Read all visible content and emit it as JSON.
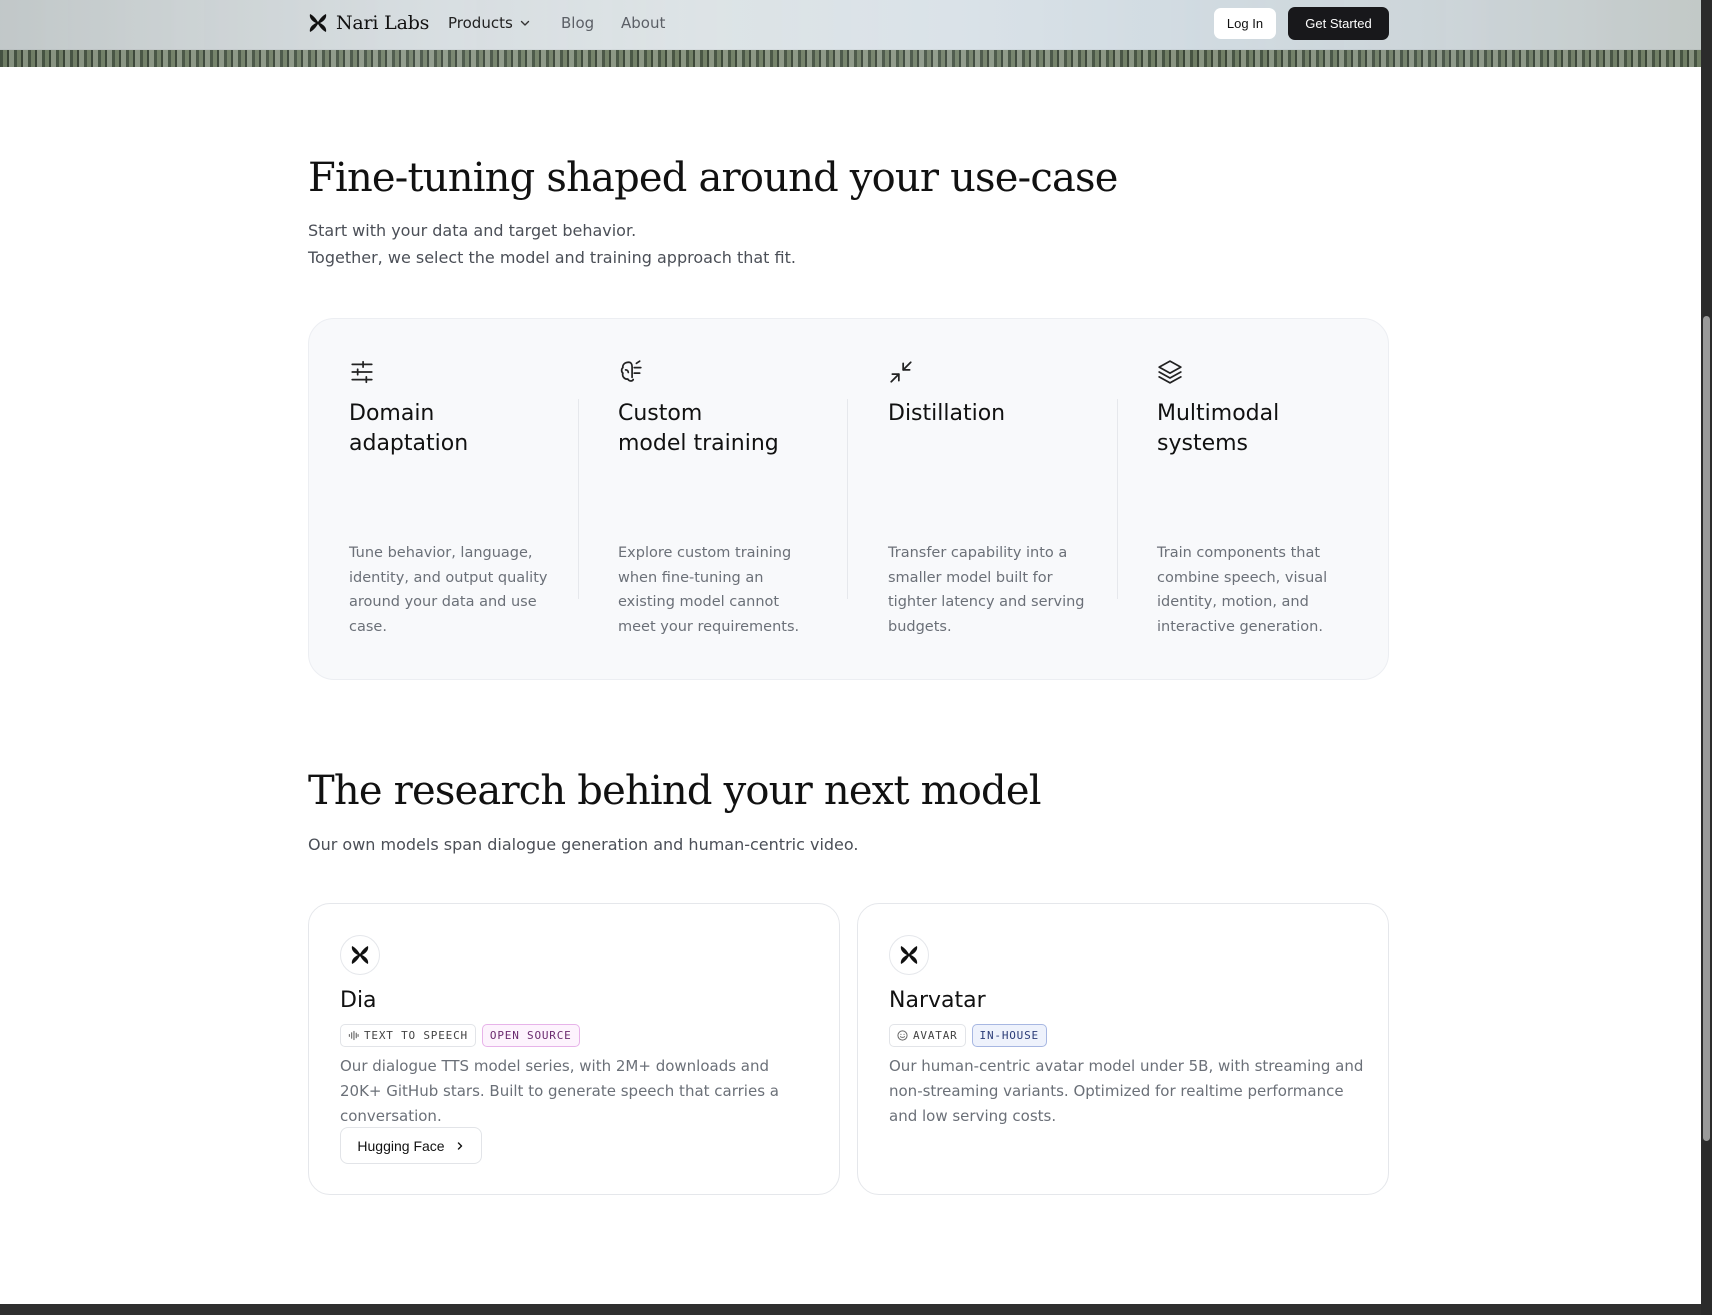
{
  "nav": {
    "brand": "Nari Labs",
    "products": "Products",
    "blog": "Blog",
    "about": "About",
    "login": "Log In",
    "get_started": "Get Started"
  },
  "finetune": {
    "title": "Fine-tuning shaped around your use-case",
    "lede_line1": "Start with your data and target behavior.",
    "lede_line2": "Together, we select the model and training approach that fit.",
    "capabilities": [
      {
        "icon": "sliders-icon",
        "title_line1": "Domain",
        "title_line2": "adaptation",
        "desc": "Tune behavior, language, identity, and output quality around your data and use case."
      },
      {
        "icon": "brain-icon",
        "title_line1": "Custom",
        "title_line2": "model training",
        "desc": "Explore custom training when fine-tuning an existing model cannot meet your requirements."
      },
      {
        "icon": "minimize-icon",
        "title_line1": "Distillation",
        "title_line2": "",
        "desc": "Transfer capability into a smaller model built for tighter latency and serving budgets."
      },
      {
        "icon": "layers-icon",
        "title_line1": "Multimodal",
        "title_line2": "systems",
        "desc": "Train components that combine speech, visual identity, motion, and interactive generation."
      }
    ]
  },
  "research": {
    "title": "The research behind your next model",
    "lede": "Our own models span dialogue generation and human-centric video.",
    "models": [
      {
        "name": "Dia",
        "tag1": "TEXT TO SPEECH",
        "tag1_icon": "audio-waveform-icon",
        "tag2": "OPEN SOURCE",
        "desc": "Our dialogue TTS model series, with 2M+ downloads and 20K+ GitHub stars. Built to generate speech that carries a conversation.",
        "button": "Hugging Face"
      },
      {
        "name": "Narvatar",
        "tag1": "AVATAR",
        "tag1_icon": "smiley-icon",
        "tag2": "IN-HOUSE",
        "desc": "Our human-centric avatar model under 5B, with streaming and non-streaming variants. Optimized for realtime performance and low serving costs."
      }
    ]
  },
  "colors": {
    "accent": "#18181b",
    "open_source_tag": "#fdf3fd",
    "in_house_tag": "#eef2fc"
  }
}
